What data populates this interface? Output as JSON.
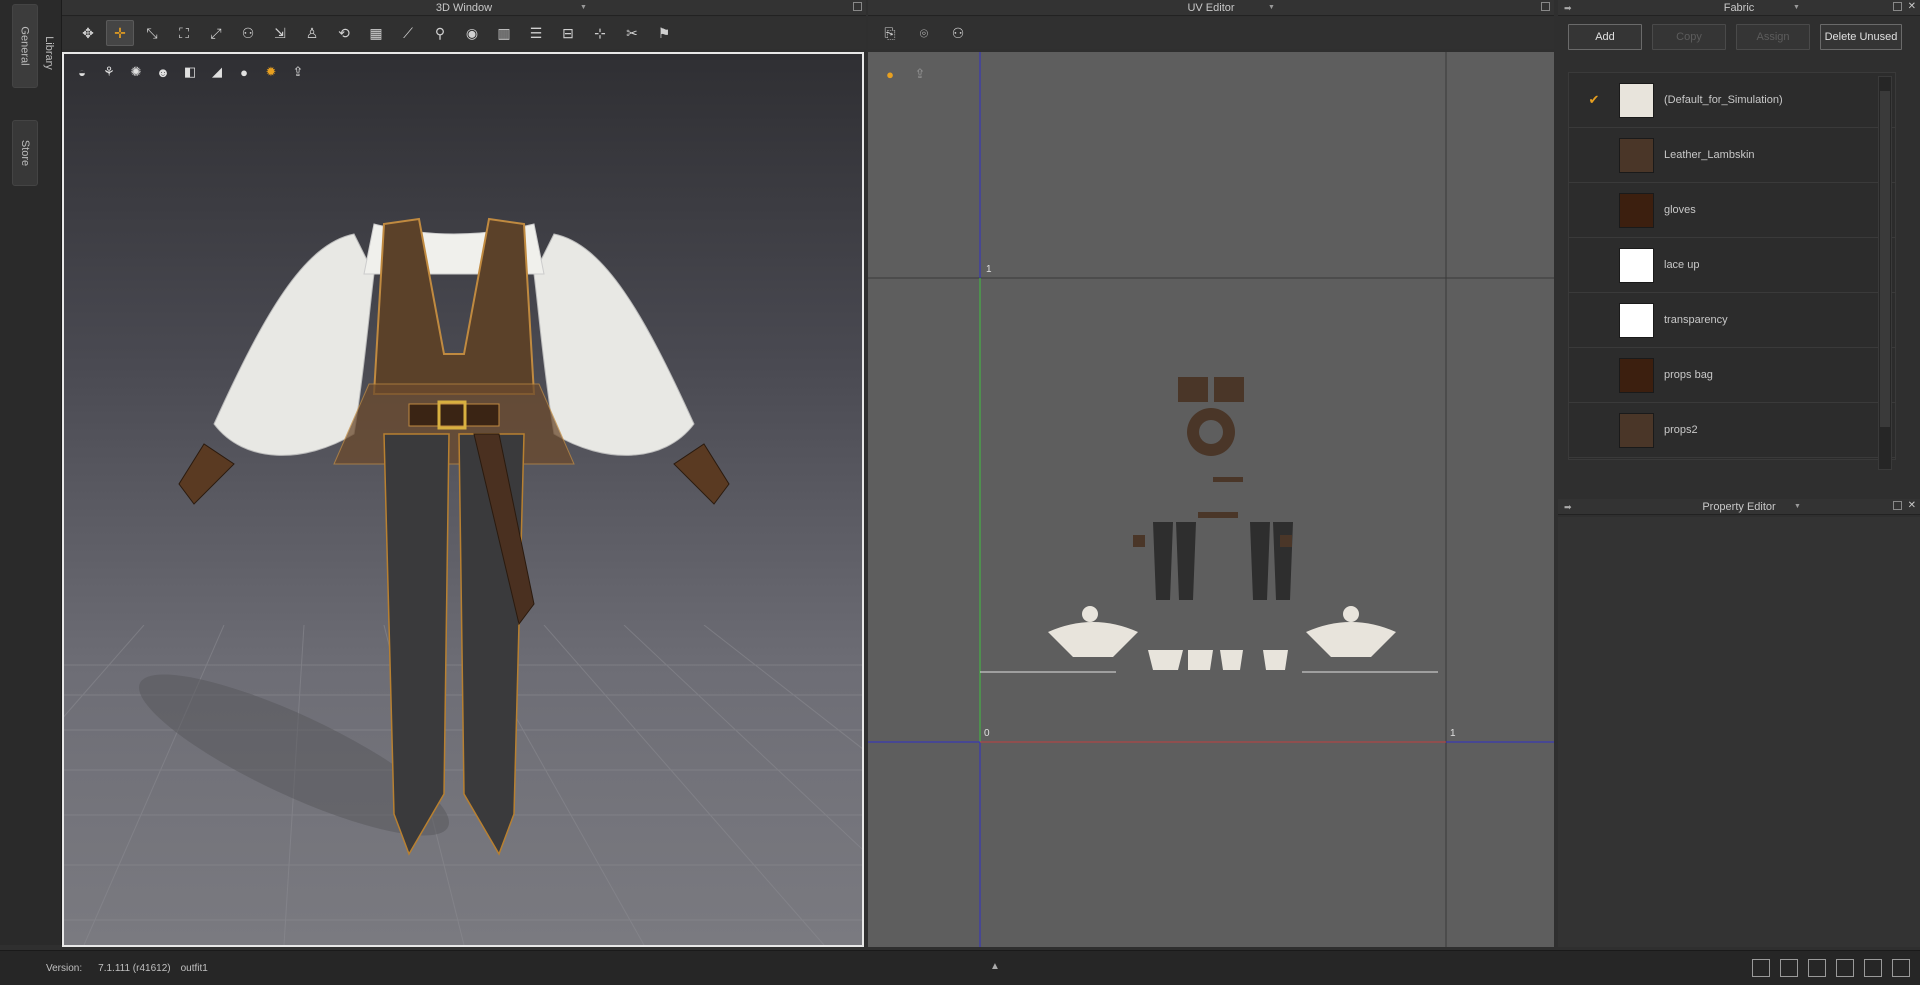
{
  "left_tabs": {
    "general": "General",
    "library": "Library",
    "store": "Store"
  },
  "window3d": {
    "title": "3D Window",
    "toolbar": [
      "select-mesh-icon",
      "move-icon",
      "edit-pin-icon",
      "garment-icon",
      "pin-icon",
      "fold-icon",
      "tack-icon",
      "avatar-icon",
      "arrange-icon",
      "grid-icon",
      "brush-icon",
      "sew-icon",
      "point-icon",
      "ruler-icon",
      "measure-icon",
      "length-icon",
      "gap-icon",
      "cut-icon",
      "walk-icon"
    ],
    "viewport_tools": [
      "shade-icon",
      "fabric-view-icon",
      "texture-icon",
      "avatar-view-icon",
      "stitch-icon",
      "plane-icon",
      "hide-avatar-icon",
      "sun-icon",
      "export-icon"
    ]
  },
  "uv_editor": {
    "title": "UV Editor",
    "toolbar": [
      "snapshot-uv-icon",
      "snapshot-camera-icon",
      "arrange-uv-icon"
    ],
    "tools": [
      "sun-icon",
      "export-icon"
    ],
    "axis_labels": {
      "top_one": "1",
      "origin_zero": "0",
      "right_one": "1"
    }
  },
  "fabric": {
    "title": "Fabric",
    "buttons": {
      "add": "Add",
      "copy": "Copy",
      "assign": "Assign",
      "delete_unused": "Delete Unused"
    },
    "items": [
      {
        "name": "(Default_for_Simulation)",
        "color": "#e8e4dc",
        "checked": true
      },
      {
        "name": "Leather_Lambskin",
        "color": "#4a3628",
        "checked": false
      },
      {
        "name": "gloves",
        "color": "#3c1f0f",
        "checked": false
      },
      {
        "name": "lace up",
        "color": "#ffffff",
        "checked": false
      },
      {
        "name": "transparency",
        "color": "#ffffff",
        "checked": false
      },
      {
        "name": "props bag",
        "color": "#3c1f0f",
        "checked": false
      },
      {
        "name": "props2",
        "color": "#4a3628",
        "checked": false
      }
    ]
  },
  "property_editor": {
    "title": "Property Editor"
  },
  "status": {
    "version_label": "Version:",
    "version_value": "7.1.111 (r41612)",
    "file": "outfit1"
  },
  "colors": {
    "accent": "#e8a020",
    "uv_red": "#c04040",
    "uv_blue": "#3030c8",
    "uv_green": "#40c040"
  }
}
